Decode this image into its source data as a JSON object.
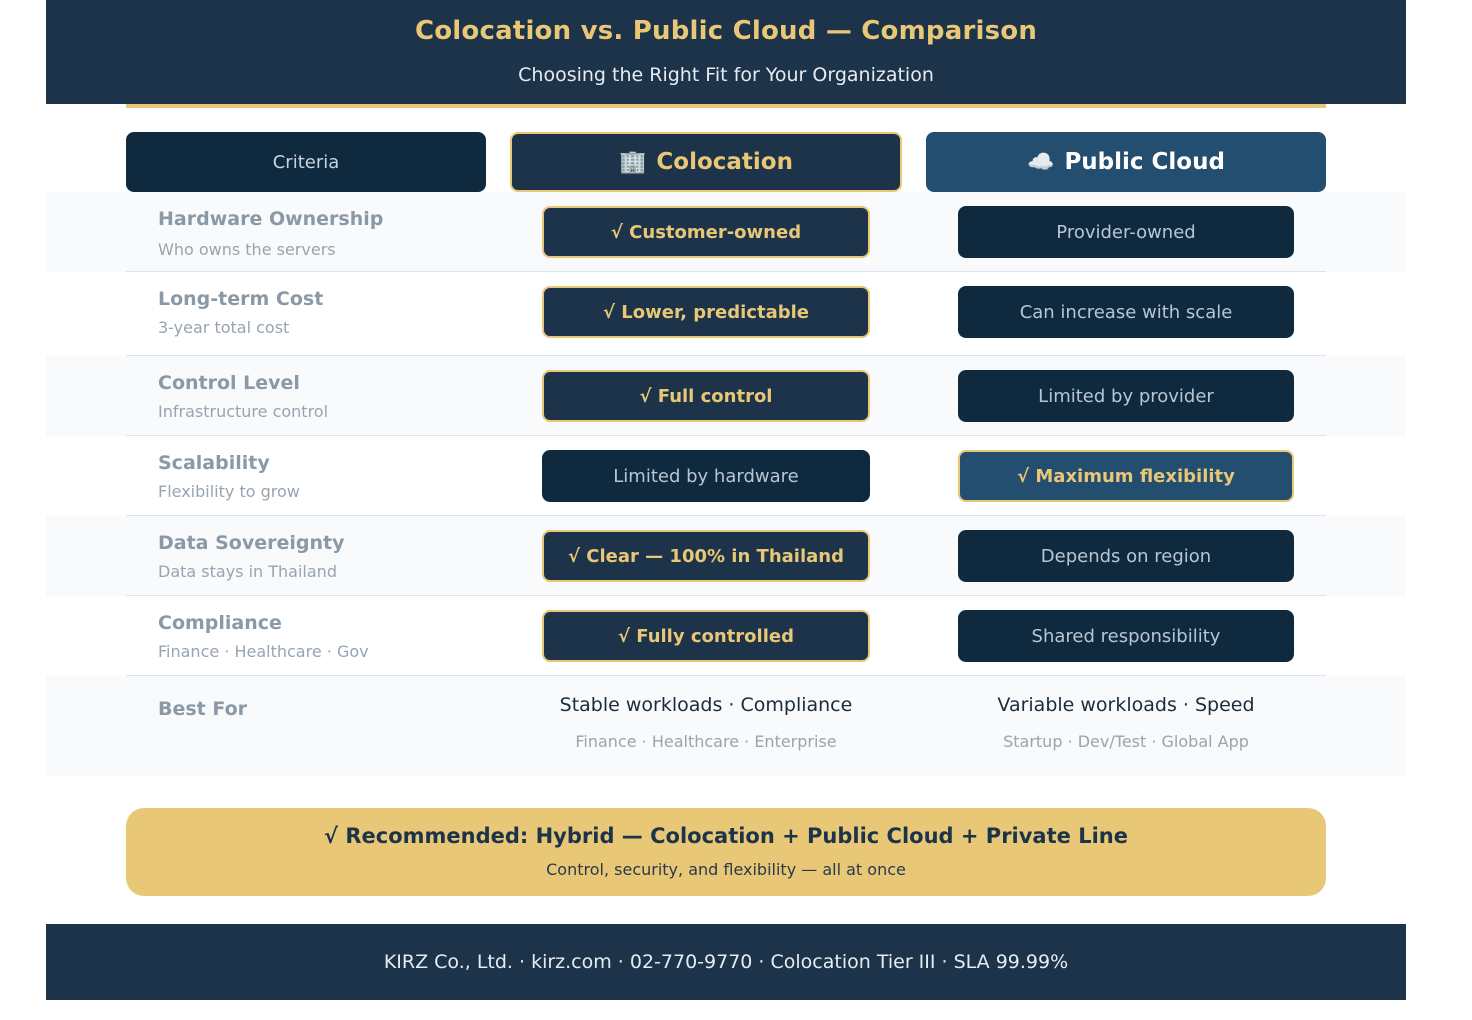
{
  "header": {
    "title": "Colocation vs. Public Cloud — Comparison",
    "subtitle": "Choosing the Right Fit for Your Organization"
  },
  "columns": {
    "criteria": "Criteria",
    "colocation": {
      "icon": "building-icon",
      "glyph": "🏢",
      "label": "Colocation"
    },
    "cloud": {
      "icon": "cloud-icon",
      "glyph": "☁️",
      "label": "Public Cloud"
    }
  },
  "rows": [
    {
      "title": "Hardware Ownership",
      "subtitle": "Who owns the servers",
      "colocation": "√ Customer-owned",
      "cloud": "Provider-owned",
      "winner": "colocation"
    },
    {
      "title": "Long-term Cost",
      "subtitle": "3-year total cost",
      "colocation": "√ Lower, predictable",
      "cloud": "Can increase with scale",
      "winner": "colocation"
    },
    {
      "title": "Control Level",
      "subtitle": "Infrastructure control",
      "colocation": "√ Full control",
      "cloud": "Limited by provider",
      "winner": "colocation"
    },
    {
      "title": "Scalability",
      "subtitle": "Flexibility to grow",
      "colocation": "Limited by hardware",
      "cloud": "√ Maximum flexibility",
      "winner": "cloud"
    },
    {
      "title": "Data Sovereignty",
      "subtitle": "Data stays in Thailand",
      "colocation": "√ Clear — 100% in Thailand",
      "cloud": "Depends on region",
      "winner": "colocation"
    },
    {
      "title": "Compliance",
      "subtitle": "Finance · Healthcare · Gov",
      "colocation": "√ Fully controlled",
      "cloud": "Shared responsibility",
      "winner": "colocation"
    }
  ],
  "best_for": {
    "title": "Best For",
    "colocation_main": "Stable workloads · Compliance",
    "colocation_sub": "Finance · Healthcare · Enterprise",
    "cloud_main": "Variable workloads · Speed",
    "cloud_sub": "Startup · Dev/Test · Global App"
  },
  "recommendation": {
    "title": "√ Recommended: Hybrid — Colocation + Public Cloud + Private Line",
    "subtitle": "Control, security, and flexibility — all at once"
  },
  "footer": {
    "text": "KIRZ Co., Ltd. · kirz.com · 02-770-9770 · Colocation Tier III · SLA 99.99%"
  },
  "colors": {
    "navy": "#1c3349",
    "dark_navy": "#0f2a3f",
    "steel_blue": "#244e70",
    "gold": "#e8c777"
  }
}
